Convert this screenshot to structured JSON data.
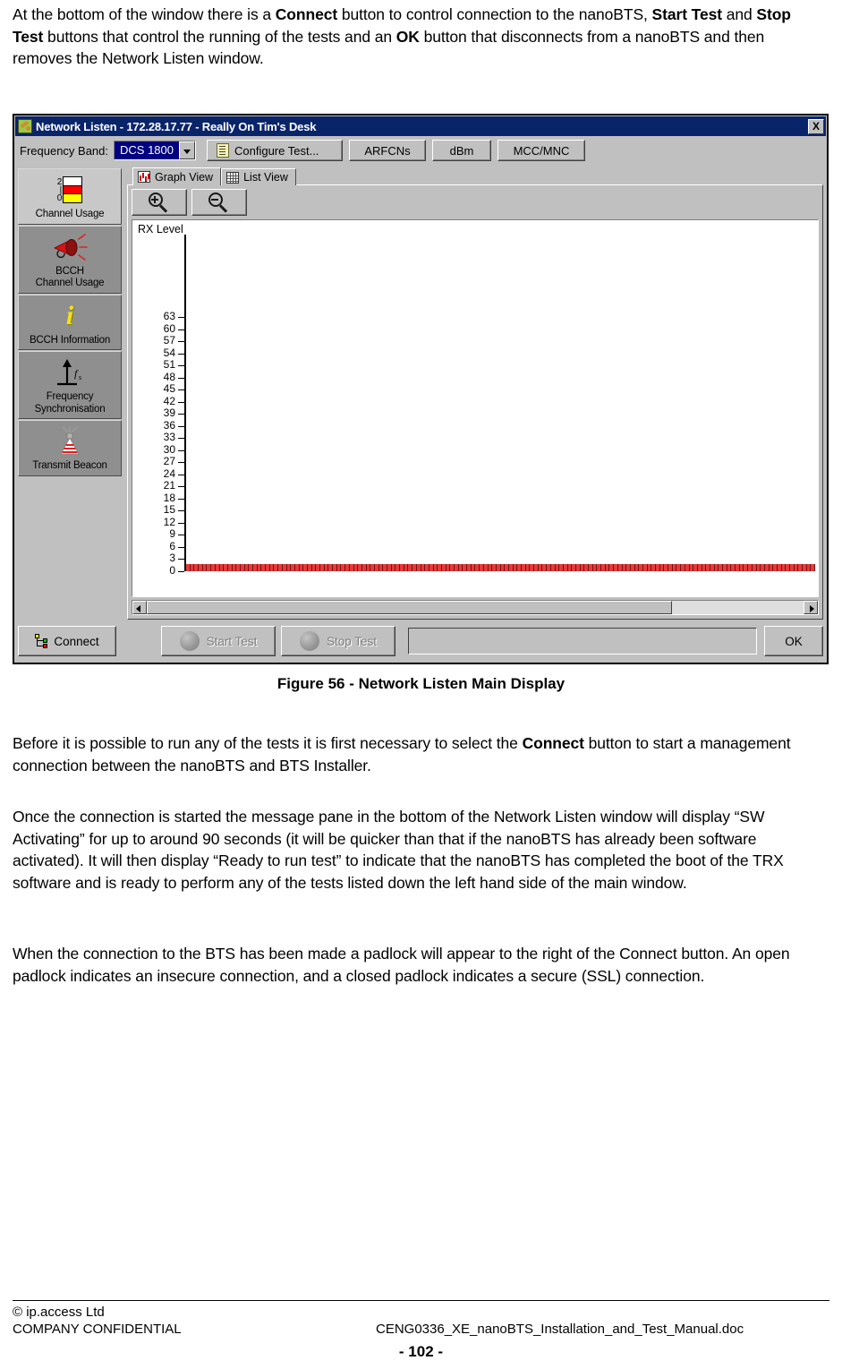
{
  "document": {
    "intro_paragraph": {
      "segments": [
        {
          "t": "At the bottom of the window there is a ",
          "b": false
        },
        {
          "t": "Connect",
          "b": true
        },
        {
          "t": " button to control connection to the nanoBTS, ",
          "b": false
        },
        {
          "t": "Start Test",
          "b": true
        },
        {
          "t": " and ",
          "b": false
        },
        {
          "t": "Stop Test",
          "b": true
        },
        {
          "t": " buttons that control the running of the tests and an ",
          "b": false
        },
        {
          "t": "OK",
          "b": true
        },
        {
          "t": "  button that disconnects from a nanoBTS and then removes the Network Listen window.",
          "b": false
        }
      ]
    },
    "figure_caption": "Figure 56 - Network Listen Main Display",
    "para_2": {
      "segments": [
        {
          "t": "Before it is possible to run any of the tests it is first necessary to select the ",
          "b": false
        },
        {
          "t": "Connect",
          "b": true
        },
        {
          "t": " button to start a management connection between the nanoBTS and BTS Installer.",
          "b": false
        }
      ]
    },
    "para_3": {
      "segments": [
        {
          "t": "Once the connection is started the message pane in the bottom of the Network Listen window will display “SW Activating” for up to around 90 seconds (it will be quicker than that if the nanoBTS has already been software activated). It will then display “Ready to run test” to indicate that the nanoBTS has completed the boot of the TRX software and is ready to perform any of the tests listed down the left hand side of the main window.",
          "b": false
        }
      ]
    },
    "para_4": {
      "segments": [
        {
          "t": "When the connection to the BTS has been made a padlock will appear to the right of the Connect button. An open padlock indicates an insecure connection, and a closed padlock indicates a secure (SSL) connection.",
          "b": false
        }
      ]
    }
  },
  "footer": {
    "copyright": "© ip.access Ltd",
    "confidential": "COMPANY CONFIDENTIAL",
    "filename": "CENG0336_XE_nanoBTS_Installation_and_Test_Manual.doc",
    "page_number": "- 102 -"
  },
  "window": {
    "title": "Network Listen - 172.28.17.77 - Really On Tim's Desk",
    "title_icon": "app-puzzle-icon",
    "close_label": "X",
    "toolbar": {
      "frequency_band_label": "Frequency Band:",
      "frequency_band_value": "DCS 1800",
      "frequency_band_options": [
        "DCS 1800"
      ],
      "configure_test_label": "Configure Test...",
      "arfcns_label": "ARFCNs",
      "dbm_label": "dBm",
      "mcc_mnc_label": "MCC/MNC"
    },
    "sidebar": {
      "items": [
        {
          "label": "Channel Usage",
          "icon": "bar-meter-icon",
          "selected": true
        },
        {
          "label": "BCCH\nChannel Usage",
          "icon": "megaphone-icon",
          "selected": false
        },
        {
          "label": "BCCH Information",
          "icon": "info-italic-icon",
          "selected": false
        },
        {
          "label": "Frequency\nSynchronisation",
          "icon": "up-arrow-fs-icon",
          "selected": false
        },
        {
          "label": "Transmit Beacon",
          "icon": "beacon-antenna-icon",
          "selected": false
        }
      ]
    },
    "tabs": [
      {
        "label": "Graph View",
        "icon": "bar-chart-icon",
        "active": true
      },
      {
        "label": "List View",
        "icon": "table-grid-icon",
        "active": false
      }
    ],
    "graph_toolbar": {
      "zoom_in": "zoom-in-icon",
      "zoom_out": "zoom-out-icon"
    },
    "bottom_bar": {
      "connect_label": "Connect",
      "start_test_label": "Start Test",
      "stop_test_label": "Stop Test",
      "ok_label": "OK",
      "message_pane_value": "",
      "start_test_enabled": false,
      "stop_test_enabled": false
    },
    "scrollbar": {
      "left_arrow": "arrow-left-icon",
      "right_arrow": "arrow-right-icon",
      "thumb_fraction": 0.8
    }
  },
  "chart_data": {
    "type": "bar",
    "title": "RX Level",
    "xlabel": "",
    "ylabel": "RX Level",
    "ylim": [
      0,
      63
    ],
    "ytick_step": 3,
    "yticks": [
      63,
      60,
      57,
      54,
      51,
      48,
      45,
      42,
      39,
      36,
      33,
      30,
      27,
      24,
      21,
      18,
      15,
      12,
      9,
      6,
      3,
      0
    ],
    "categories": [],
    "values": [],
    "bar_count": 150,
    "bar_color": "#e33b3b",
    "note": "All bars at zero level - no data captured yet (not connected)",
    "grid": false,
    "legend": false
  }
}
